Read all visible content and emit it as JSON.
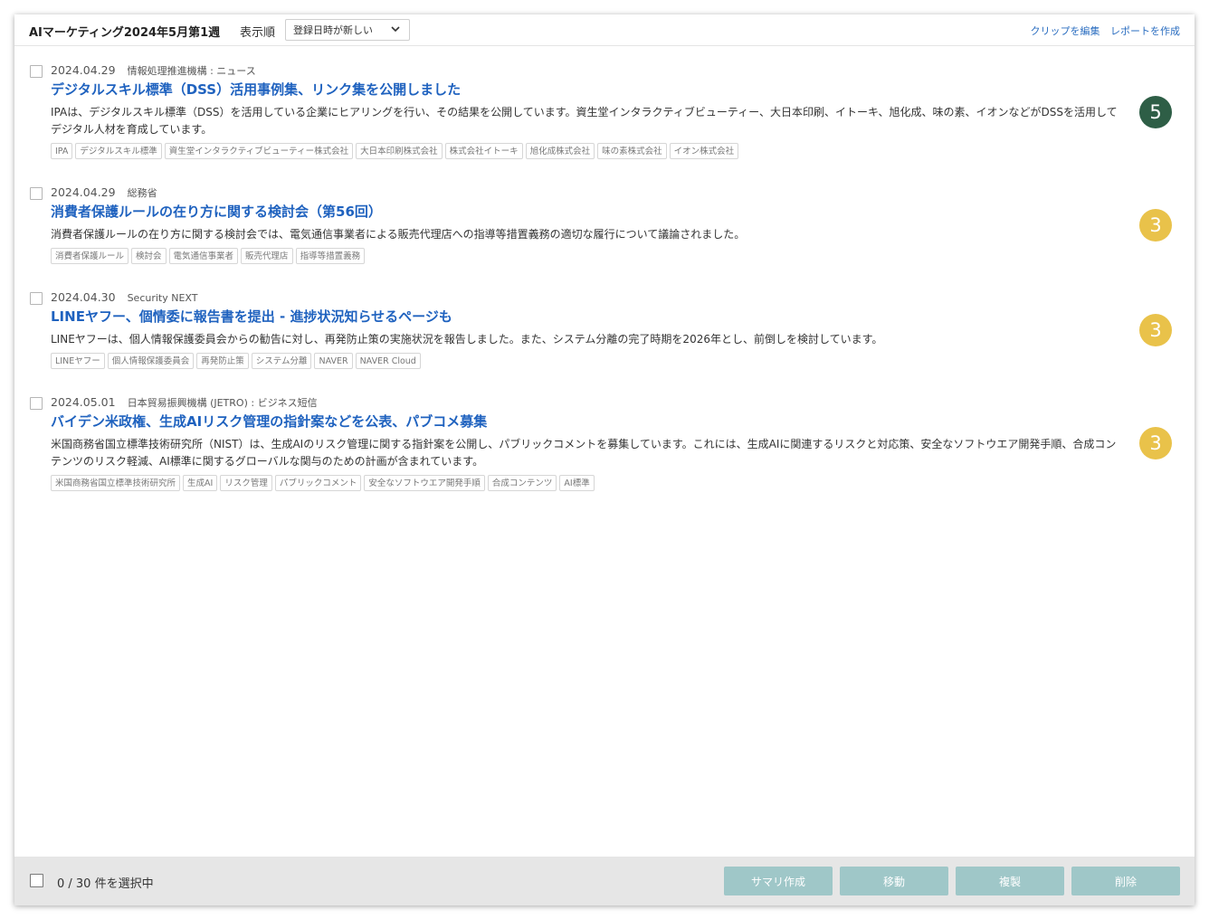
{
  "header": {
    "clip_title": "AIマーケティング2024年5月第1週",
    "sort_label": "表示順",
    "sort_value": "登録日時が新しい",
    "edit_clip_link": "クリップを編集",
    "create_report_link": "レポートを作成"
  },
  "colors": {
    "link": "#1f62bf",
    "badge_high": "#2e5e46",
    "badge_mid": "#e9c24a",
    "footer_button": "#9fc7c8"
  },
  "articles": [
    {
      "date": "2024.04.29",
      "source": "情報処理推進機構 : ニュース",
      "title": "デジタルスキル標準（DSS）活用事例集、リンク集を公開しました",
      "summary": "IPAは、デジタルスキル標準（DSS）を活用している企業にヒアリングを行い、その結果を公開しています。資生堂インタラクティブビューティー、大日本印刷、イトーキ、旭化成、味の素、イオンなどがDSSを活用してデジタル人材を育成しています。",
      "tags": [
        "IPA",
        "デジタルスキル標準",
        "資生堂インタラクティブビューティー株式会社",
        "大日本印刷株式会社",
        "株式会社イトーキ",
        "旭化成株式会社",
        "味の素株式会社",
        "イオン株式会社"
      ],
      "score": "5"
    },
    {
      "date": "2024.04.29",
      "source": "総務省",
      "title": "消費者保護ルールの在り方に関する検討会（第56回）",
      "summary": "消費者保護ルールの在り方に関する検討会では、電気通信事業者による販売代理店への指導等措置義務の適切な履行について議論されました。",
      "tags": [
        "消費者保護ルール",
        "検討会",
        "電気通信事業者",
        "販売代理店",
        "指導等措置義務"
      ],
      "score": "3"
    },
    {
      "date": "2024.04.30",
      "source": "Security NEXT",
      "title": "LINEヤフー、個情委に報告書を提出 - 進捗状況知らせるページも",
      "summary": "LINEヤフーは、個人情報保護委員会からの勧告に対し、再発防止策の実施状況を報告しました。また、システム分離の完了時期を2026年とし、前倒しを検討しています。",
      "tags": [
        "LINEヤフー",
        "個人情報保護委員会",
        "再発防止策",
        "システム分離",
        "NAVER",
        "NAVER Cloud"
      ],
      "score": "3"
    },
    {
      "date": "2024.05.01",
      "source": "日本貿易振興機構 (JETRO) : ビジネス短信",
      "title": "バイデン米政権、生成AIリスク管理の指針案などを公表、パブコメ募集",
      "summary": "米国商務省国立標準技術研究所（NIST）は、生成AIのリスク管理に関する指針案を公開し、パブリックコメントを募集しています。これには、生成AIに関連するリスクと対応策、安全なソフトウエア開発手順、合成コンテンツのリスク軽減、AI標準に関するグローバルな関与のための計画が含まれています。",
      "tags": [
        "米国商務省国立標準技術研究所",
        "生成AI",
        "リスク管理",
        "パブリックコメント",
        "安全なソフトウエア開発手順",
        "合成コンテンツ",
        "AI標準"
      ],
      "score": "3"
    }
  ],
  "footer": {
    "selection_count": "0 / 30 件を選択中",
    "summary_button": "サマリ作成",
    "move_button": "移動",
    "copy_button": "複製",
    "delete_button": "削除"
  }
}
